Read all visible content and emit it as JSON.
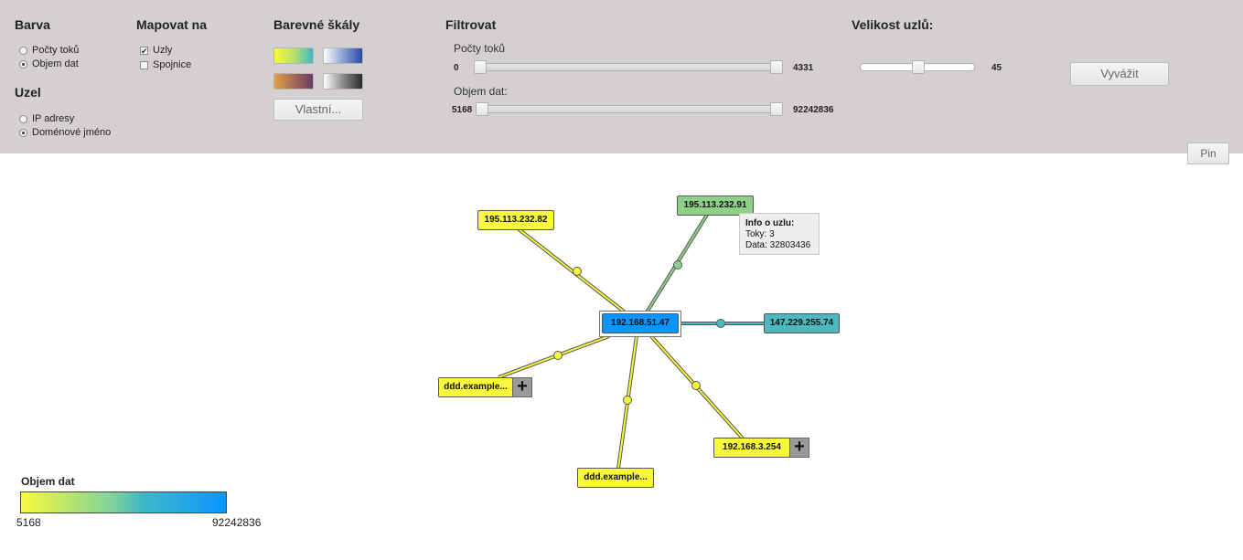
{
  "panel": {
    "color": {
      "heading": "Barva",
      "options": [
        {
          "label": "Počty toků",
          "checked": false
        },
        {
          "label": "Objem dat",
          "checked": true
        }
      ]
    },
    "node": {
      "heading": "Uzel",
      "options": [
        {
          "label": "IP adresy",
          "checked": false
        },
        {
          "label": "Doménové jméno",
          "checked": true
        }
      ]
    },
    "map_to": {
      "heading": "Mapovat na",
      "options": [
        {
          "label": "Uzly",
          "checked": true,
          "mark": "✔"
        },
        {
          "label": "Spojnice",
          "checked": false,
          "mark": ""
        }
      ]
    },
    "scales": {
      "heading": "Barevné škály",
      "custom_button": "Vlastní...",
      "swatches": [
        {
          "name": "yellow-cyan",
          "colors": [
            "#f9f93c",
            "#3fb7c9"
          ]
        },
        {
          "name": "white-blue",
          "colors": [
            "#ffffff",
            "#2b4ba6"
          ]
        },
        {
          "name": "orange-purple",
          "colors": [
            "#e0a040",
            "#6b3a6b"
          ]
        },
        {
          "name": "white-black",
          "colors": [
            "#ffffff",
            "#2a2a2a"
          ]
        }
      ]
    },
    "filter": {
      "heading": "Filtrovat",
      "flows": {
        "label": "Počty toků",
        "min": "0",
        "max": "4331"
      },
      "data": {
        "label": "Objem dat:",
        "min": "5168",
        "max": "92242836"
      }
    },
    "size": {
      "heading": "Velikost uzlů:",
      "value": "45",
      "level": 0.45
    },
    "balance_button": "Vyvážit",
    "pin_button": "Pin"
  },
  "graph": {
    "center": {
      "label": "192.168.51.47",
      "color": "#0b96ff"
    },
    "nodes": [
      {
        "id": "n1",
        "label": "195.113.232.82",
        "color": "#f9f93c",
        "expandable": false
      },
      {
        "id": "n2",
        "label": "195.113.232.91",
        "color": "#8fd089",
        "expandable": false
      },
      {
        "id": "n3",
        "label": "147.229.255.74",
        "color": "#4fb8be",
        "expandable": false
      },
      {
        "id": "n4",
        "label": "ddd.example...",
        "color": "#f9f93c",
        "expandable": true
      },
      {
        "id": "n5",
        "label": "ddd.example...",
        "color": "#f9f93c",
        "expandable": false
      },
      {
        "id": "n6",
        "label": "192.168.3.254",
        "color": "#f9f93c",
        "expandable": true
      }
    ],
    "tooltip": {
      "title": "Info o uzlu:",
      "flows": "Toky: 3",
      "data": "Data: 32803436"
    },
    "expand_symbol": "+"
  },
  "legend": {
    "title": "Objem dat",
    "min": "5168",
    "max": "92242836",
    "colors": [
      "#f9f93c",
      "#0b96ff"
    ]
  }
}
